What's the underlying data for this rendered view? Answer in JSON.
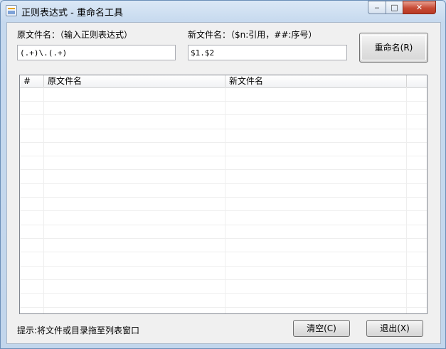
{
  "window": {
    "title": "正则表达式 - 重命名工具",
    "controls": {
      "minimize": "‒",
      "maximize": "□",
      "close": "✕"
    }
  },
  "form": {
    "source_label": "原文件名：（输入正则表达式）",
    "source_value": "(.+)\\.(.+)",
    "target_label": "新文件名：（$n:引用，##:序号）",
    "target_value": "$1.$2",
    "rename_button": "重命名(R)"
  },
  "list": {
    "columns": [
      "#",
      "原文件名",
      "新文件名"
    ],
    "rows": []
  },
  "footer": {
    "hint": "提示:将文件或目录拖至列表窗口",
    "clear_button": "清空(C)",
    "exit_button": "退出(X)"
  }
}
